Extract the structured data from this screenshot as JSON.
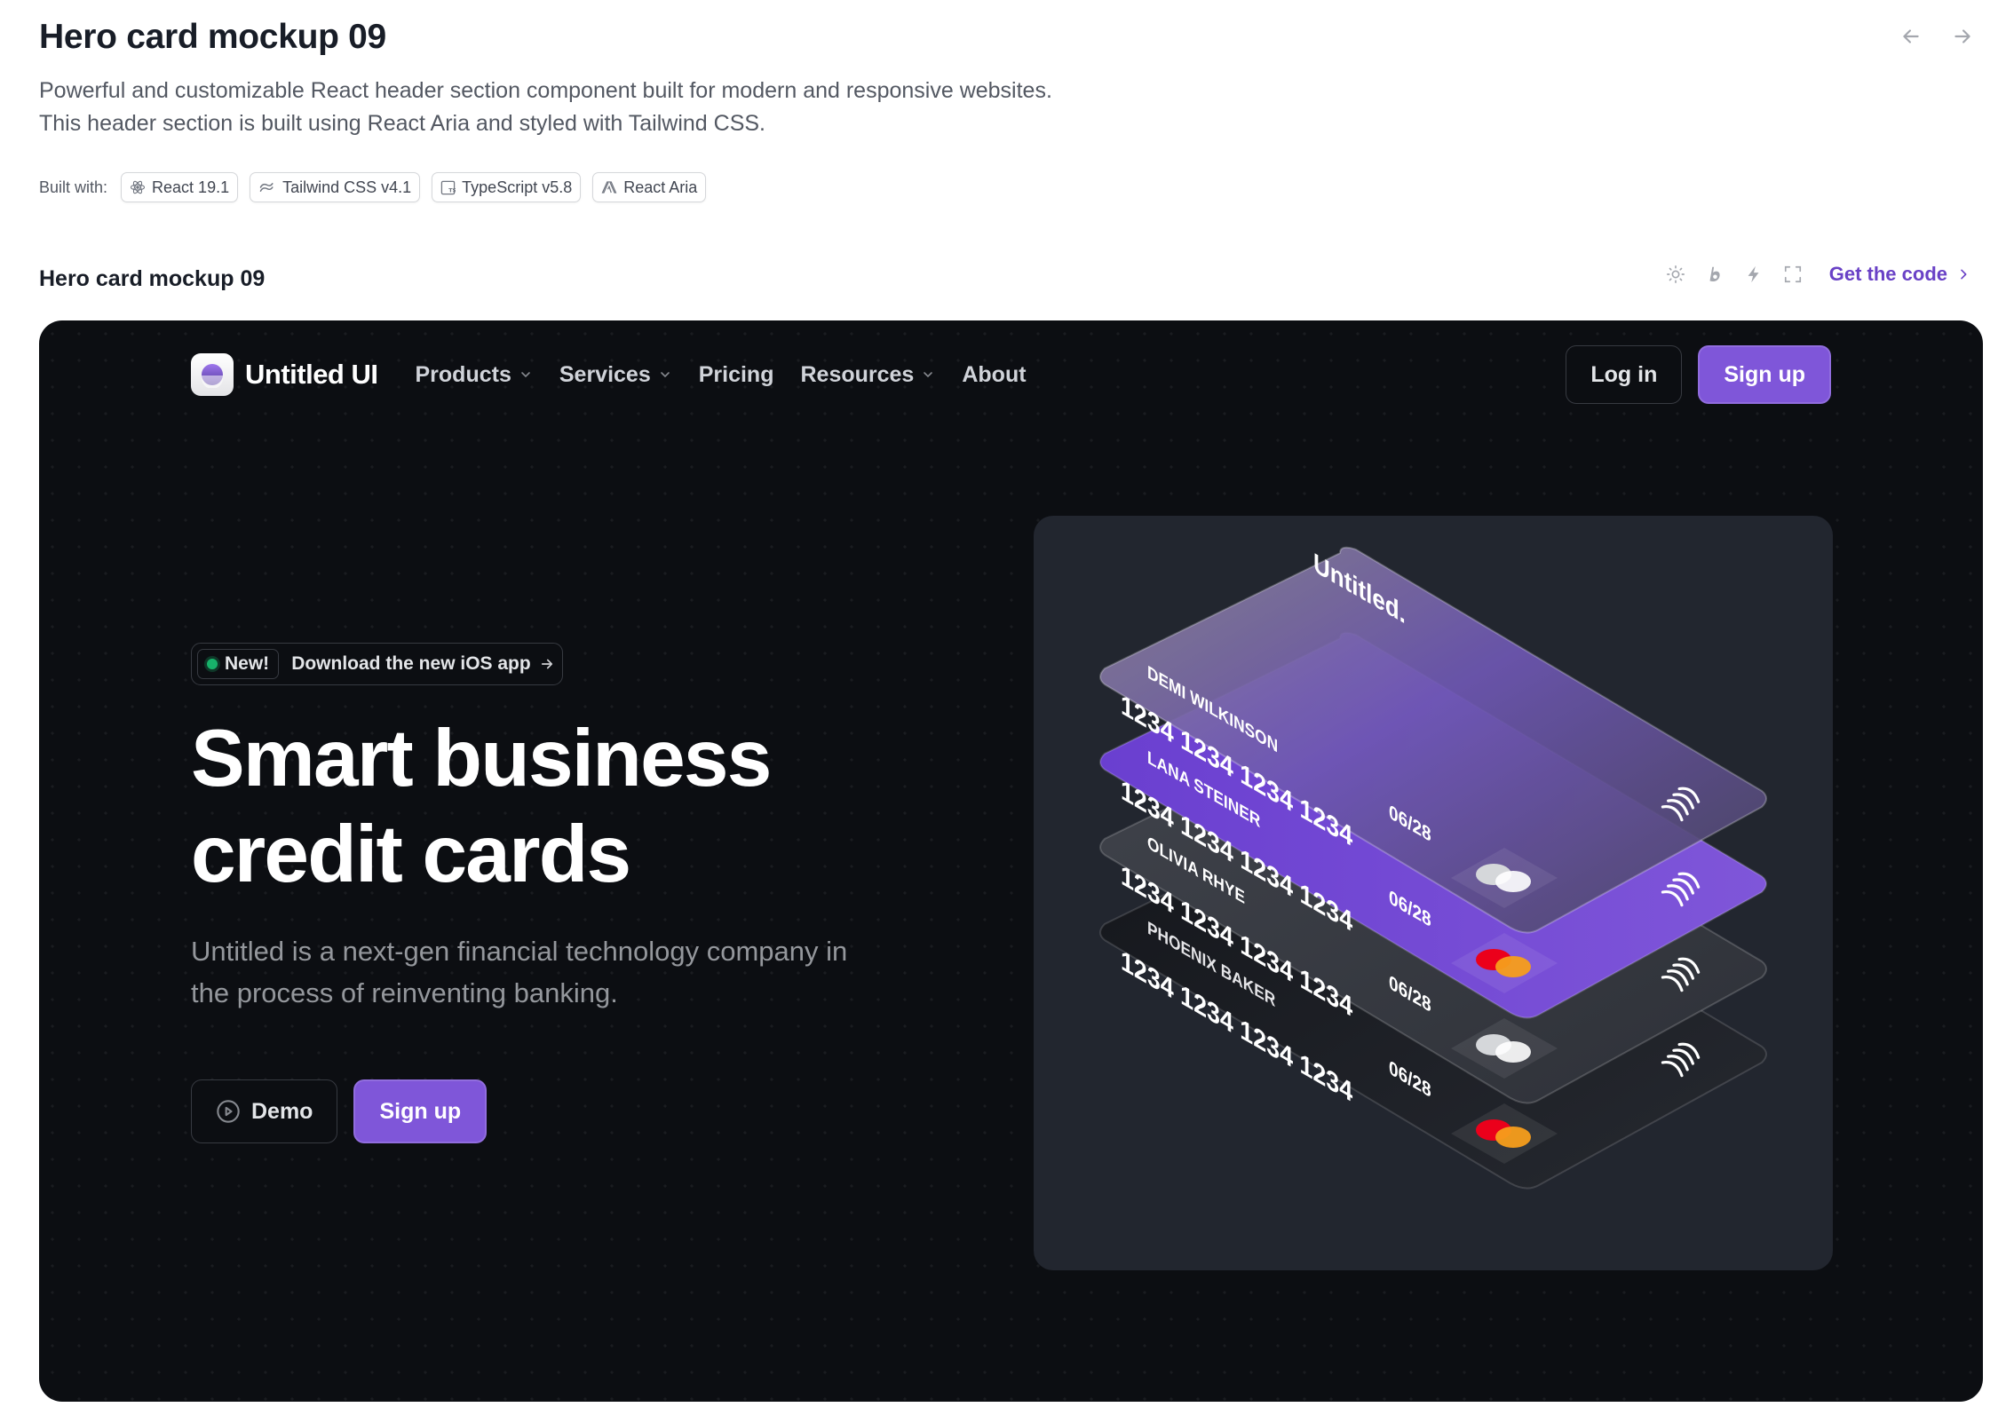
{
  "page": {
    "title": "Hero card mockup 09",
    "description": "Powerful and customizable React header section component built for modern and responsive websites. This header section is built using React Aria and styled with Tailwind CSS.",
    "built_with_label": "Built with:",
    "badges": [
      {
        "label": "React 19.1",
        "icon": "react-icon"
      },
      {
        "label": "Tailwind CSS v4.1",
        "icon": "tailwind-icon"
      },
      {
        "label": "TypeScript v5.8",
        "icon": "typescript-icon"
      },
      {
        "label": "React Aria",
        "icon": "adobe-icon"
      }
    ]
  },
  "section": {
    "title": "Hero card mockup 09",
    "tools": [
      "sun-icon",
      "bolt-b-icon",
      "lightning-icon",
      "fullscreen-icon"
    ],
    "get_code": "Get the code"
  },
  "preview": {
    "logo_text": "Untitled UI",
    "nav": [
      {
        "label": "Products",
        "dropdown": true
      },
      {
        "label": "Services",
        "dropdown": true
      },
      {
        "label": "Pricing",
        "dropdown": false
      },
      {
        "label": "Resources",
        "dropdown": true
      },
      {
        "label": "About",
        "dropdown": false
      }
    ],
    "login": "Log in",
    "signup": "Sign up",
    "badge_new": "New!",
    "badge_message": "Download the new iOS app",
    "hero_title_line1": "Smart business",
    "hero_title_line2": "credit cards",
    "hero_sub": "Untitled is a next-gen financial technology company in the process of reinventing banking.",
    "cta_demo": "Demo",
    "cta_signup": "Sign up",
    "cards": [
      {
        "brand": "Untitled.",
        "name": "DEMI WILKINSON",
        "number": "1234 1234 1234 1234",
        "expiry": "06/28",
        "style": "glass"
      },
      {
        "brand": "",
        "name": "LANA STEINER",
        "number": "1234 1234 1234 1234",
        "expiry": "06/28",
        "style": "purple"
      },
      {
        "brand": "",
        "name": "OLIVIA RHYE",
        "number": "1234 1234 1234 1234",
        "expiry": "06/28",
        "style": "gray"
      },
      {
        "brand": "",
        "name": "PHOENIX BAKER",
        "number": "1234 1234 1234 1234",
        "expiry": "06/28",
        "style": "dark"
      }
    ],
    "colors": {
      "accent": "#7f56d9",
      "background": "#0c0e12",
      "mockup": "#22262f",
      "success": "#17b26a"
    }
  }
}
